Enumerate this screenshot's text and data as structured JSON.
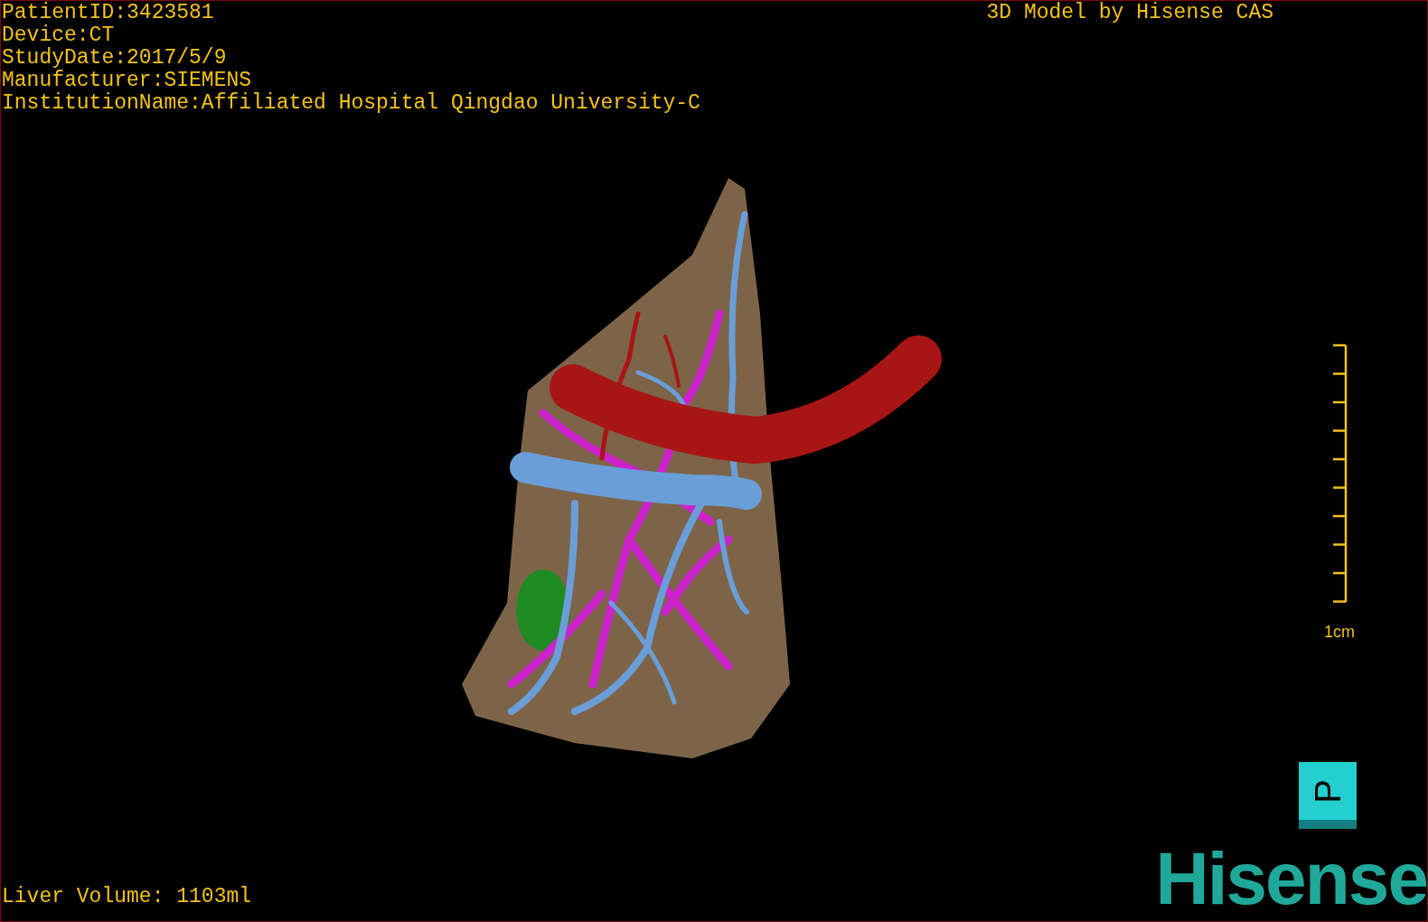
{
  "patient_info": [
    "PatientID:3423581",
    "Device:CT",
    "StudyDate:2017/5/9",
    "Manufacturer:SIEMENS",
    "InstitutionName:Affiliated Hospital Qingdao University-C"
  ],
  "title": "3D Model by Hisense CAS",
  "scale_bar": {
    "label": "1cm"
  },
  "orientation_cube": {
    "label": "P"
  },
  "liver_volume": "Liver Volume: 1103ml",
  "logo": "Hisense"
}
